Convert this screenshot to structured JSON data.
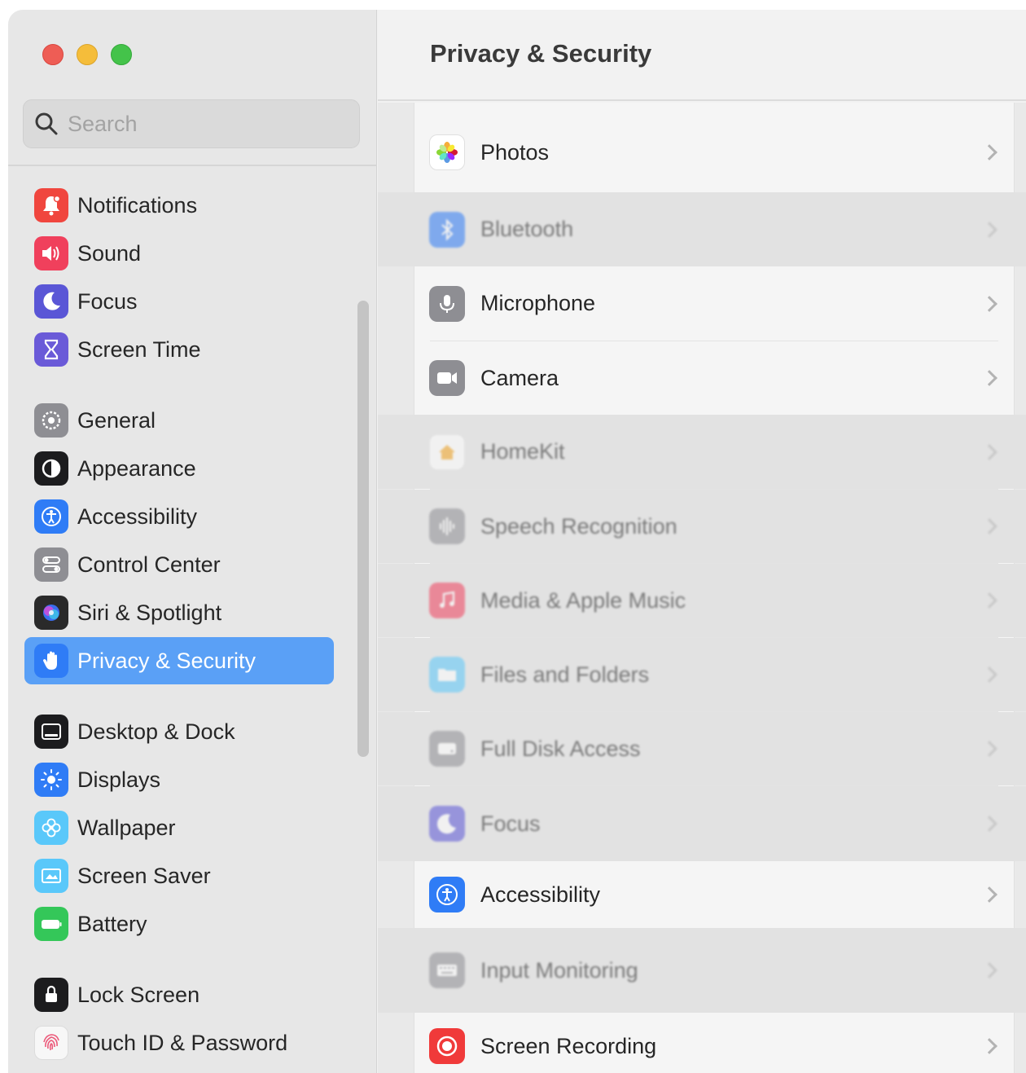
{
  "window": {
    "controls": [
      "close",
      "minimize",
      "maximize"
    ]
  },
  "search": {
    "placeholder": "Search",
    "value": ""
  },
  "sidebar": {
    "items": [
      {
        "label": "Notifications",
        "icon": "bell-icon",
        "color": "#f0463e"
      },
      {
        "label": "Sound",
        "icon": "speaker-icon",
        "color": "#f0405c"
      },
      {
        "label": "Focus",
        "icon": "moon-icon",
        "color": "#5a56d6"
      },
      {
        "label": "Screen Time",
        "icon": "hourglass-icon",
        "color": "#6a5ad8"
      },
      {
        "label": "General",
        "icon": "gear-icon",
        "color": "#8e8e93"
      },
      {
        "label": "Appearance",
        "icon": "appearance-icon",
        "color": "#1c1c1e"
      },
      {
        "label": "Accessibility",
        "icon": "accessibility-icon",
        "color": "#2f7cf6"
      },
      {
        "label": "Control Center",
        "icon": "control-center-icon",
        "color": "#8e8e93"
      },
      {
        "label": "Siri & Spotlight",
        "icon": "siri-icon",
        "color": "#2a2a2a"
      },
      {
        "label": "Privacy & Security",
        "icon": "hand-icon",
        "color": "#2f7cf6",
        "selected": true
      },
      {
        "label": "Desktop & Dock",
        "icon": "dock-icon",
        "color": "#1c1c1e"
      },
      {
        "label": "Displays",
        "icon": "sun-icon",
        "color": "#2f7cf6"
      },
      {
        "label": "Wallpaper",
        "icon": "flower-icon",
        "color": "#5ac8fa"
      },
      {
        "label": "Screen Saver",
        "icon": "screensaver-icon",
        "color": "#5ac8fa"
      },
      {
        "label": "Battery",
        "icon": "battery-icon",
        "color": "#34c759"
      },
      {
        "label": "Lock Screen",
        "icon": "lock-icon",
        "color": "#1c1c1e"
      },
      {
        "label": "Touch ID & Password",
        "icon": "fingerprint-icon",
        "color": "#f2f2f2"
      }
    ]
  },
  "main": {
    "title": "Privacy & Security",
    "rows": [
      {
        "label": "Photos",
        "icon": "photos-icon",
        "dim": false
      },
      {
        "label": "Bluetooth",
        "icon": "bluetooth-icon",
        "dim": true
      },
      {
        "label": "Microphone",
        "icon": "microphone-icon",
        "dim": false
      },
      {
        "label": "Camera",
        "icon": "camera-icon",
        "dim": false
      },
      {
        "label": "HomeKit",
        "icon": "home-icon",
        "dim": true
      },
      {
        "label": "Speech Recognition",
        "icon": "waveform-icon",
        "dim": true
      },
      {
        "label": "Media & Apple Music",
        "icon": "music-icon",
        "dim": true
      },
      {
        "label": "Files and Folders",
        "icon": "folder-icon",
        "dim": true
      },
      {
        "label": "Full Disk Access",
        "icon": "disk-icon",
        "dim": true
      },
      {
        "label": "Focus",
        "icon": "moon-icon",
        "dim": true
      },
      {
        "label": "Accessibility",
        "icon": "accessibility-icon",
        "dim": false
      },
      {
        "label": "Input Monitoring",
        "icon": "keyboard-icon",
        "dim": true
      },
      {
        "label": "Screen Recording",
        "icon": "record-icon",
        "dim": false
      }
    ]
  }
}
